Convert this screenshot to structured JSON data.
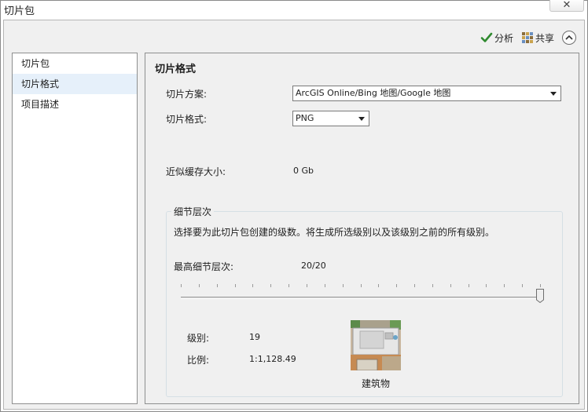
{
  "window": {
    "title": "切片包",
    "close_glyph": "✕"
  },
  "toolbar": {
    "analyze_label": "分析",
    "share_label": "共享",
    "check_icon": "check-icon",
    "share_icon": "share-icon",
    "collapse_icon": "chevron-up-icon"
  },
  "sidebar": {
    "items": [
      {
        "label": "切片包",
        "selected": false
      },
      {
        "label": "切片格式",
        "selected": true
      },
      {
        "label": "项目描述",
        "selected": false
      }
    ]
  },
  "main": {
    "title": "切片格式",
    "scheme_label": "切片方案:",
    "scheme_value": "ArcGIS Online/Bing 地图/Google 地图",
    "format_label": "切片格式:",
    "format_value": "PNG",
    "cache_label": "近似缓存大小:",
    "cache_value": "0 Gb",
    "lod": {
      "group_title": "细节层次",
      "description": "选择要为此切片包创建的级数。将生成所选级别以及该级别之前的所有级别。",
      "max_label": "最高细节层次:",
      "max_value": "20/20",
      "slider_level": 20,
      "slider_max": 20,
      "level_label": "级别:",
      "level_value": "19",
      "scale_label": "比例:",
      "scale_value": "1:1,128.49",
      "preview_caption": "建筑物"
    }
  },
  "colors": {
    "selected_bg": "#e6f0fa",
    "panel_bg": "#f0f0f0",
    "check_green": "#2f8a2f"
  }
}
